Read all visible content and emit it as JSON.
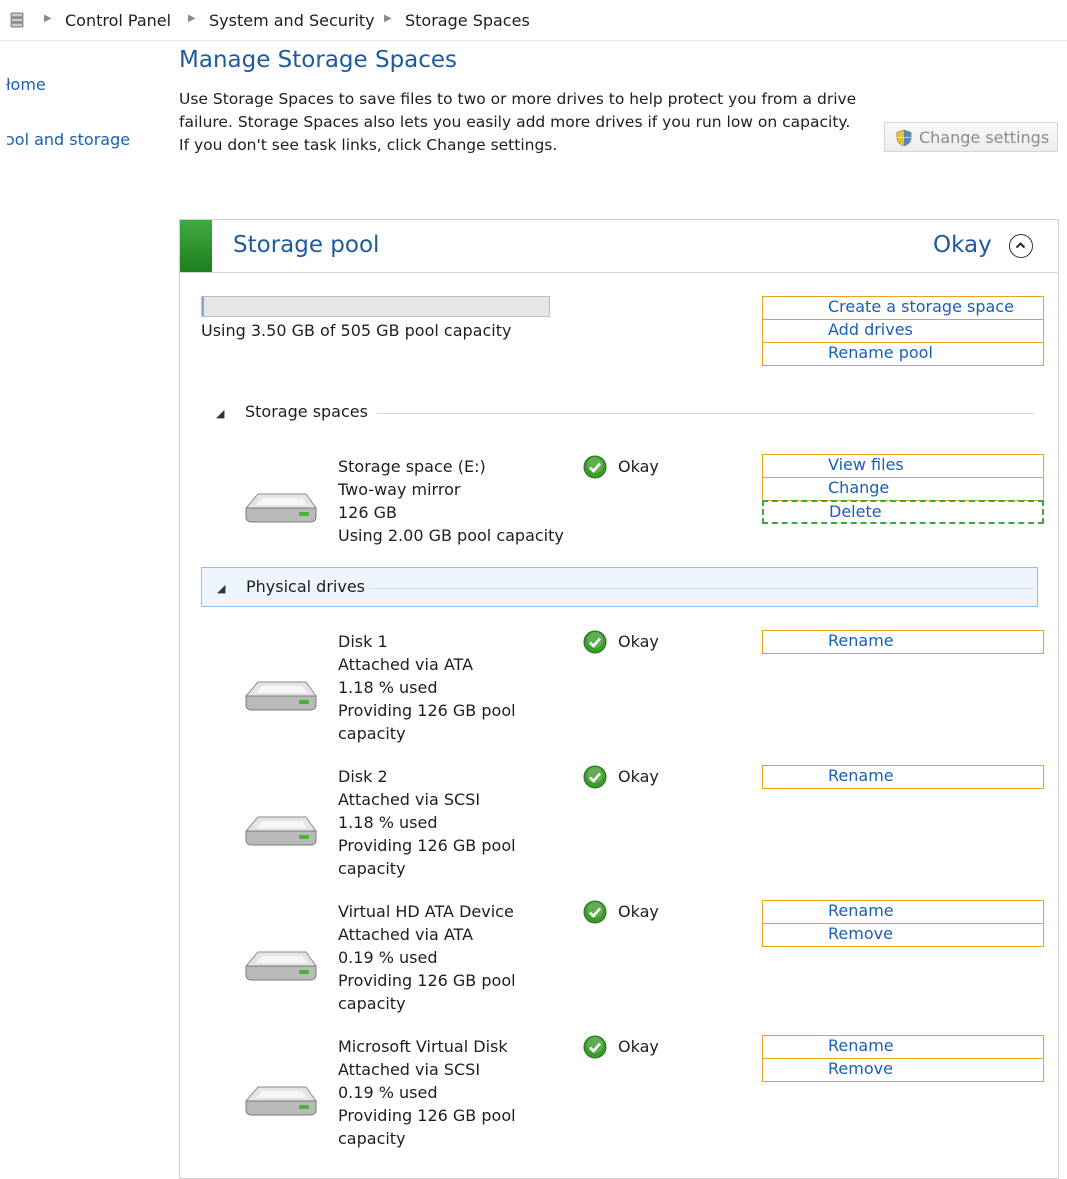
{
  "breadcrumb": [
    "Control Panel",
    "System and Security",
    "Storage Spaces"
  ],
  "left_nav": [
    "łome",
    "ɔol and storage"
  ],
  "page": {
    "title": "Manage Storage Spaces",
    "description": "Use Storage Spaces to save files to two or more drives to help protect you from a drive failure. Storage Spaces also lets you easily add more drives if you run low on capacity. If you don't see task links, click Change settings.",
    "change_settings": "Change settings"
  },
  "pool": {
    "title": "Storage pool",
    "status": "Okay",
    "capacity_text": "Using 3.50 GB of 505 GB pool capacity",
    "capacity_used_fraction": 0.0069,
    "actions": [
      "Create a storage space",
      "Add drives",
      "Rename pool"
    ]
  },
  "storage_spaces": {
    "label": "Storage spaces",
    "items": [
      {
        "lines": [
          "Storage space (E:)",
          "Two-way mirror",
          "126 GB",
          "Using 2.00 GB pool capacity"
        ],
        "status": "Okay",
        "actions": [
          "View files",
          "Change",
          "Delete"
        ]
      }
    ]
  },
  "physical_drives": {
    "label": "Physical drives",
    "items": [
      {
        "lines": [
          "Disk 1",
          "Attached via ATA",
          "1.18 % used",
          "Providing 126 GB pool",
          "capacity"
        ],
        "status": "Okay",
        "actions": [
          "Rename"
        ]
      },
      {
        "lines": [
          "Disk 2",
          "Attached via SCSI",
          "1.18 % used",
          "Providing 126 GB pool",
          "capacity"
        ],
        "status": "Okay",
        "actions": [
          "Rename"
        ]
      },
      {
        "lines": [
          "Virtual HD ATA Device",
          "Attached via ATA",
          "0.19 % used",
          "Providing 126 GB pool",
          "capacity"
        ],
        "status": "Okay",
        "actions": [
          "Rename",
          "Remove"
        ]
      },
      {
        "lines": [
          "Microsoft Virtual Disk",
          "Attached via SCSI",
          "0.19 % used",
          "Providing 126 GB pool",
          "capacity"
        ],
        "status": "Okay",
        "actions": [
          "Rename",
          "Remove"
        ]
      }
    ]
  },
  "colors": {
    "heading_blue": "#1e5a9e",
    "link_blue": "#1a5fb4",
    "action_border": "#f0a020",
    "focus_dashed": "#3aaa3a",
    "okay_green": "#3d9a2c"
  }
}
